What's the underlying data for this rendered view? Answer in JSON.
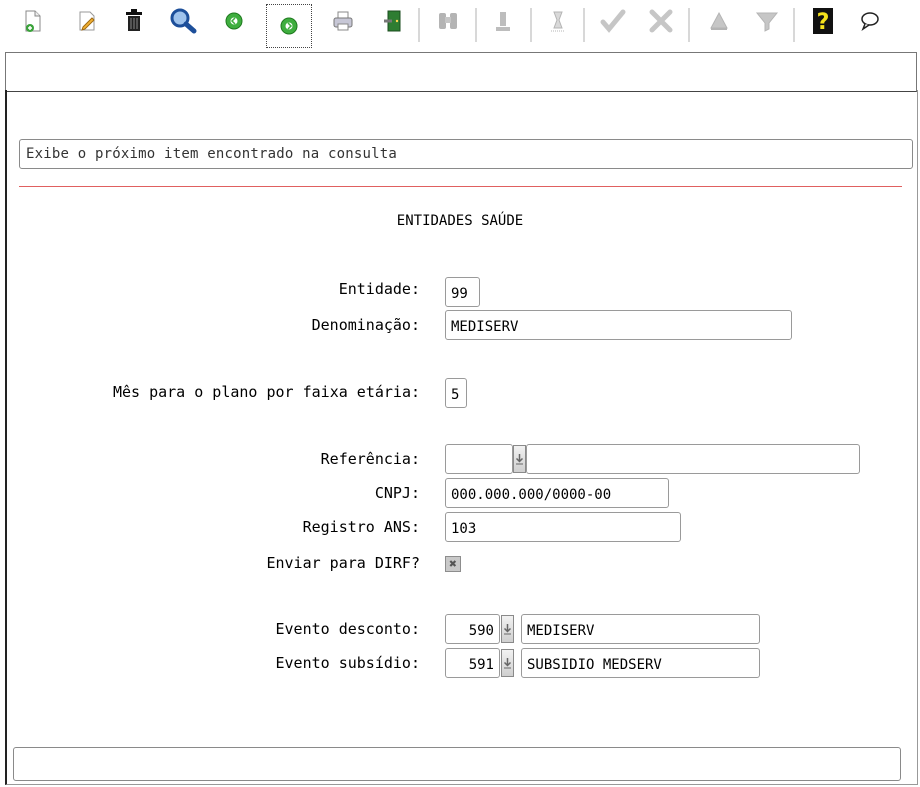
{
  "status_message": "Exibe o próximo item encontrado na consulta",
  "form_title": "ENTIDADES SAÚDE",
  "fields": {
    "entidade": {
      "label": "Entidade:",
      "value": "99"
    },
    "denominacao": {
      "label": "Denominação:",
      "value": "MEDISERV"
    },
    "mes_plano": {
      "label": "Mês para o plano por faixa etária:",
      "value": "5"
    },
    "referencia": {
      "label": "Referência:",
      "value": "",
      "description": ""
    },
    "cnpj": {
      "label": "CNPJ:",
      "value": "000.000.000/0000-00"
    },
    "registro_ans": {
      "label": "Registro ANS:",
      "value": "103"
    },
    "enviar_dirf": {
      "label": "Enviar para DIRF?",
      "checked": true,
      "mark": "✖"
    },
    "evento_desconto": {
      "label": "Evento desconto:",
      "code": "590",
      "description": "MEDISERV"
    },
    "evento_subsidio": {
      "label": "Evento subsídio:",
      "code": "591",
      "description": "SUBSIDIO MEDSERV"
    }
  },
  "bottom_status": ""
}
